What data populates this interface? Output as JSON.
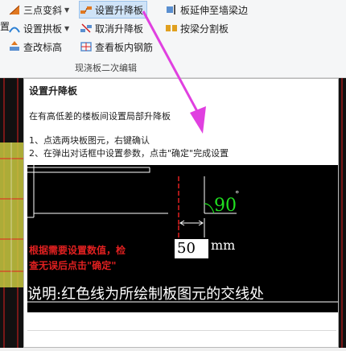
{
  "ribbon": {
    "col1": {
      "three_point_slope": "三点变斜",
      "set_arch_slab": "设置拱板",
      "check_elevation": "查改标高"
    },
    "col2": {
      "set_lift_slab": "设置升降板",
      "cancel_lift_slab": "取消升降板",
      "view_slab_rebar": "查看板内钢筋"
    },
    "col3": {
      "extend_slab_to_wall": "板延伸至墙梁边",
      "split_by_beam": "按梁分割板"
    },
    "group_label": "现浇板二次编辑",
    "left_fragment": "置"
  },
  "tooltip": {
    "title": "设置升降板",
    "description": "在有高低差的楼板间设置局部升降板",
    "step1": "1、点选两块板图元，右键确认",
    "step2": "2、在弹出对话框中设置参数，点击\"确定\"完成设置",
    "image": {
      "callout_line1": "根据需要设置数值，检",
      "callout_line2": "查无误后点击\"确定\"",
      "input_value": "50",
      "unit": "mm",
      "angle": "90",
      "degree_mark": "°",
      "caption": "说明:红色线为所绘制板图元的交线处"
    }
  },
  "colors": {
    "magenta_arrow": "#e040e0",
    "red_line": "#e02020",
    "green_text": "#20e020"
  }
}
